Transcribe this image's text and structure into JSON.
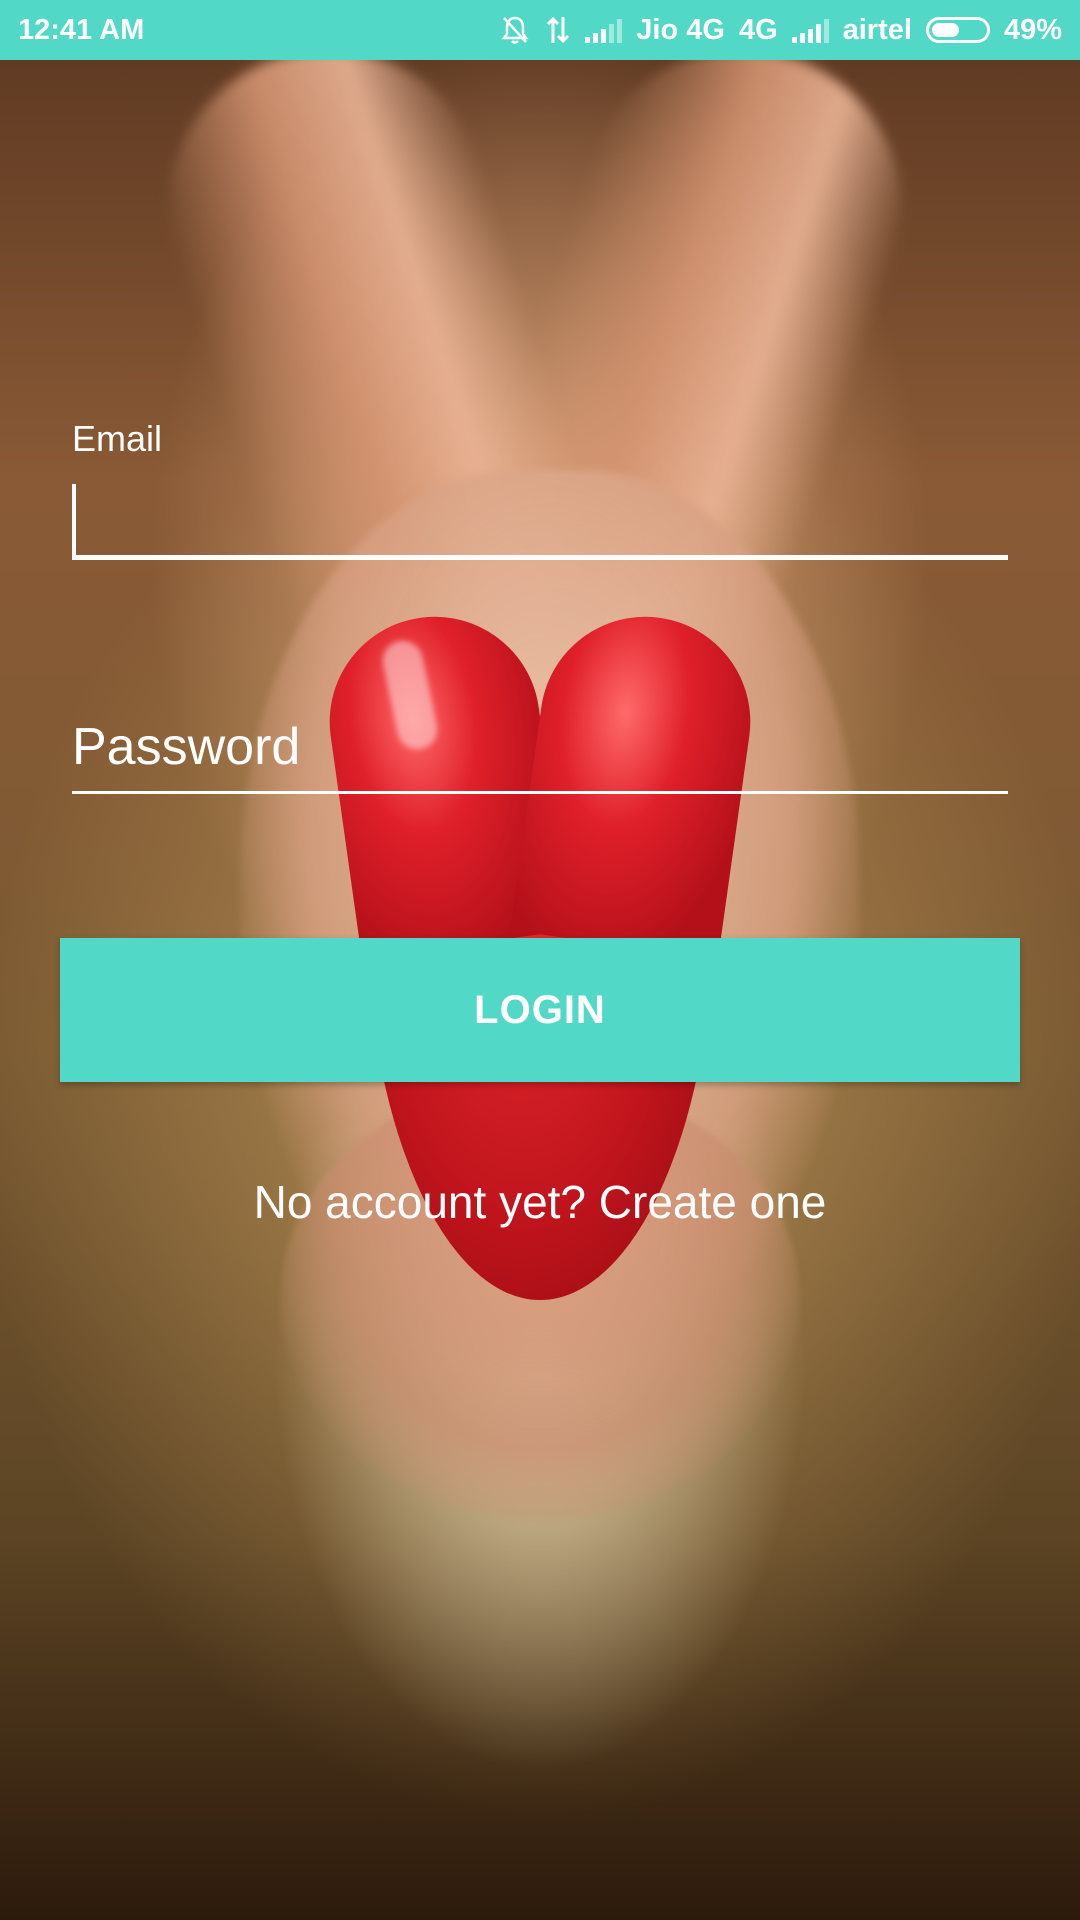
{
  "status_bar": {
    "time": "12:41 AM",
    "carrier1": "Jio 4G",
    "network_type": "4G",
    "carrier2": "airtel",
    "battery": "49%",
    "background": "#52d8c6",
    "icons": [
      "bell-off-icon",
      "data-arrows-icon",
      "signal-icon",
      "battery-icon"
    ]
  },
  "form": {
    "email_label": "Email",
    "email_value": "",
    "password_placeholder": "Password",
    "login_label": "LOGIN",
    "create_account_text": "No account yet? Create one"
  },
  "theme": {
    "accent": "#52d8c6",
    "text": "#ffffff"
  }
}
